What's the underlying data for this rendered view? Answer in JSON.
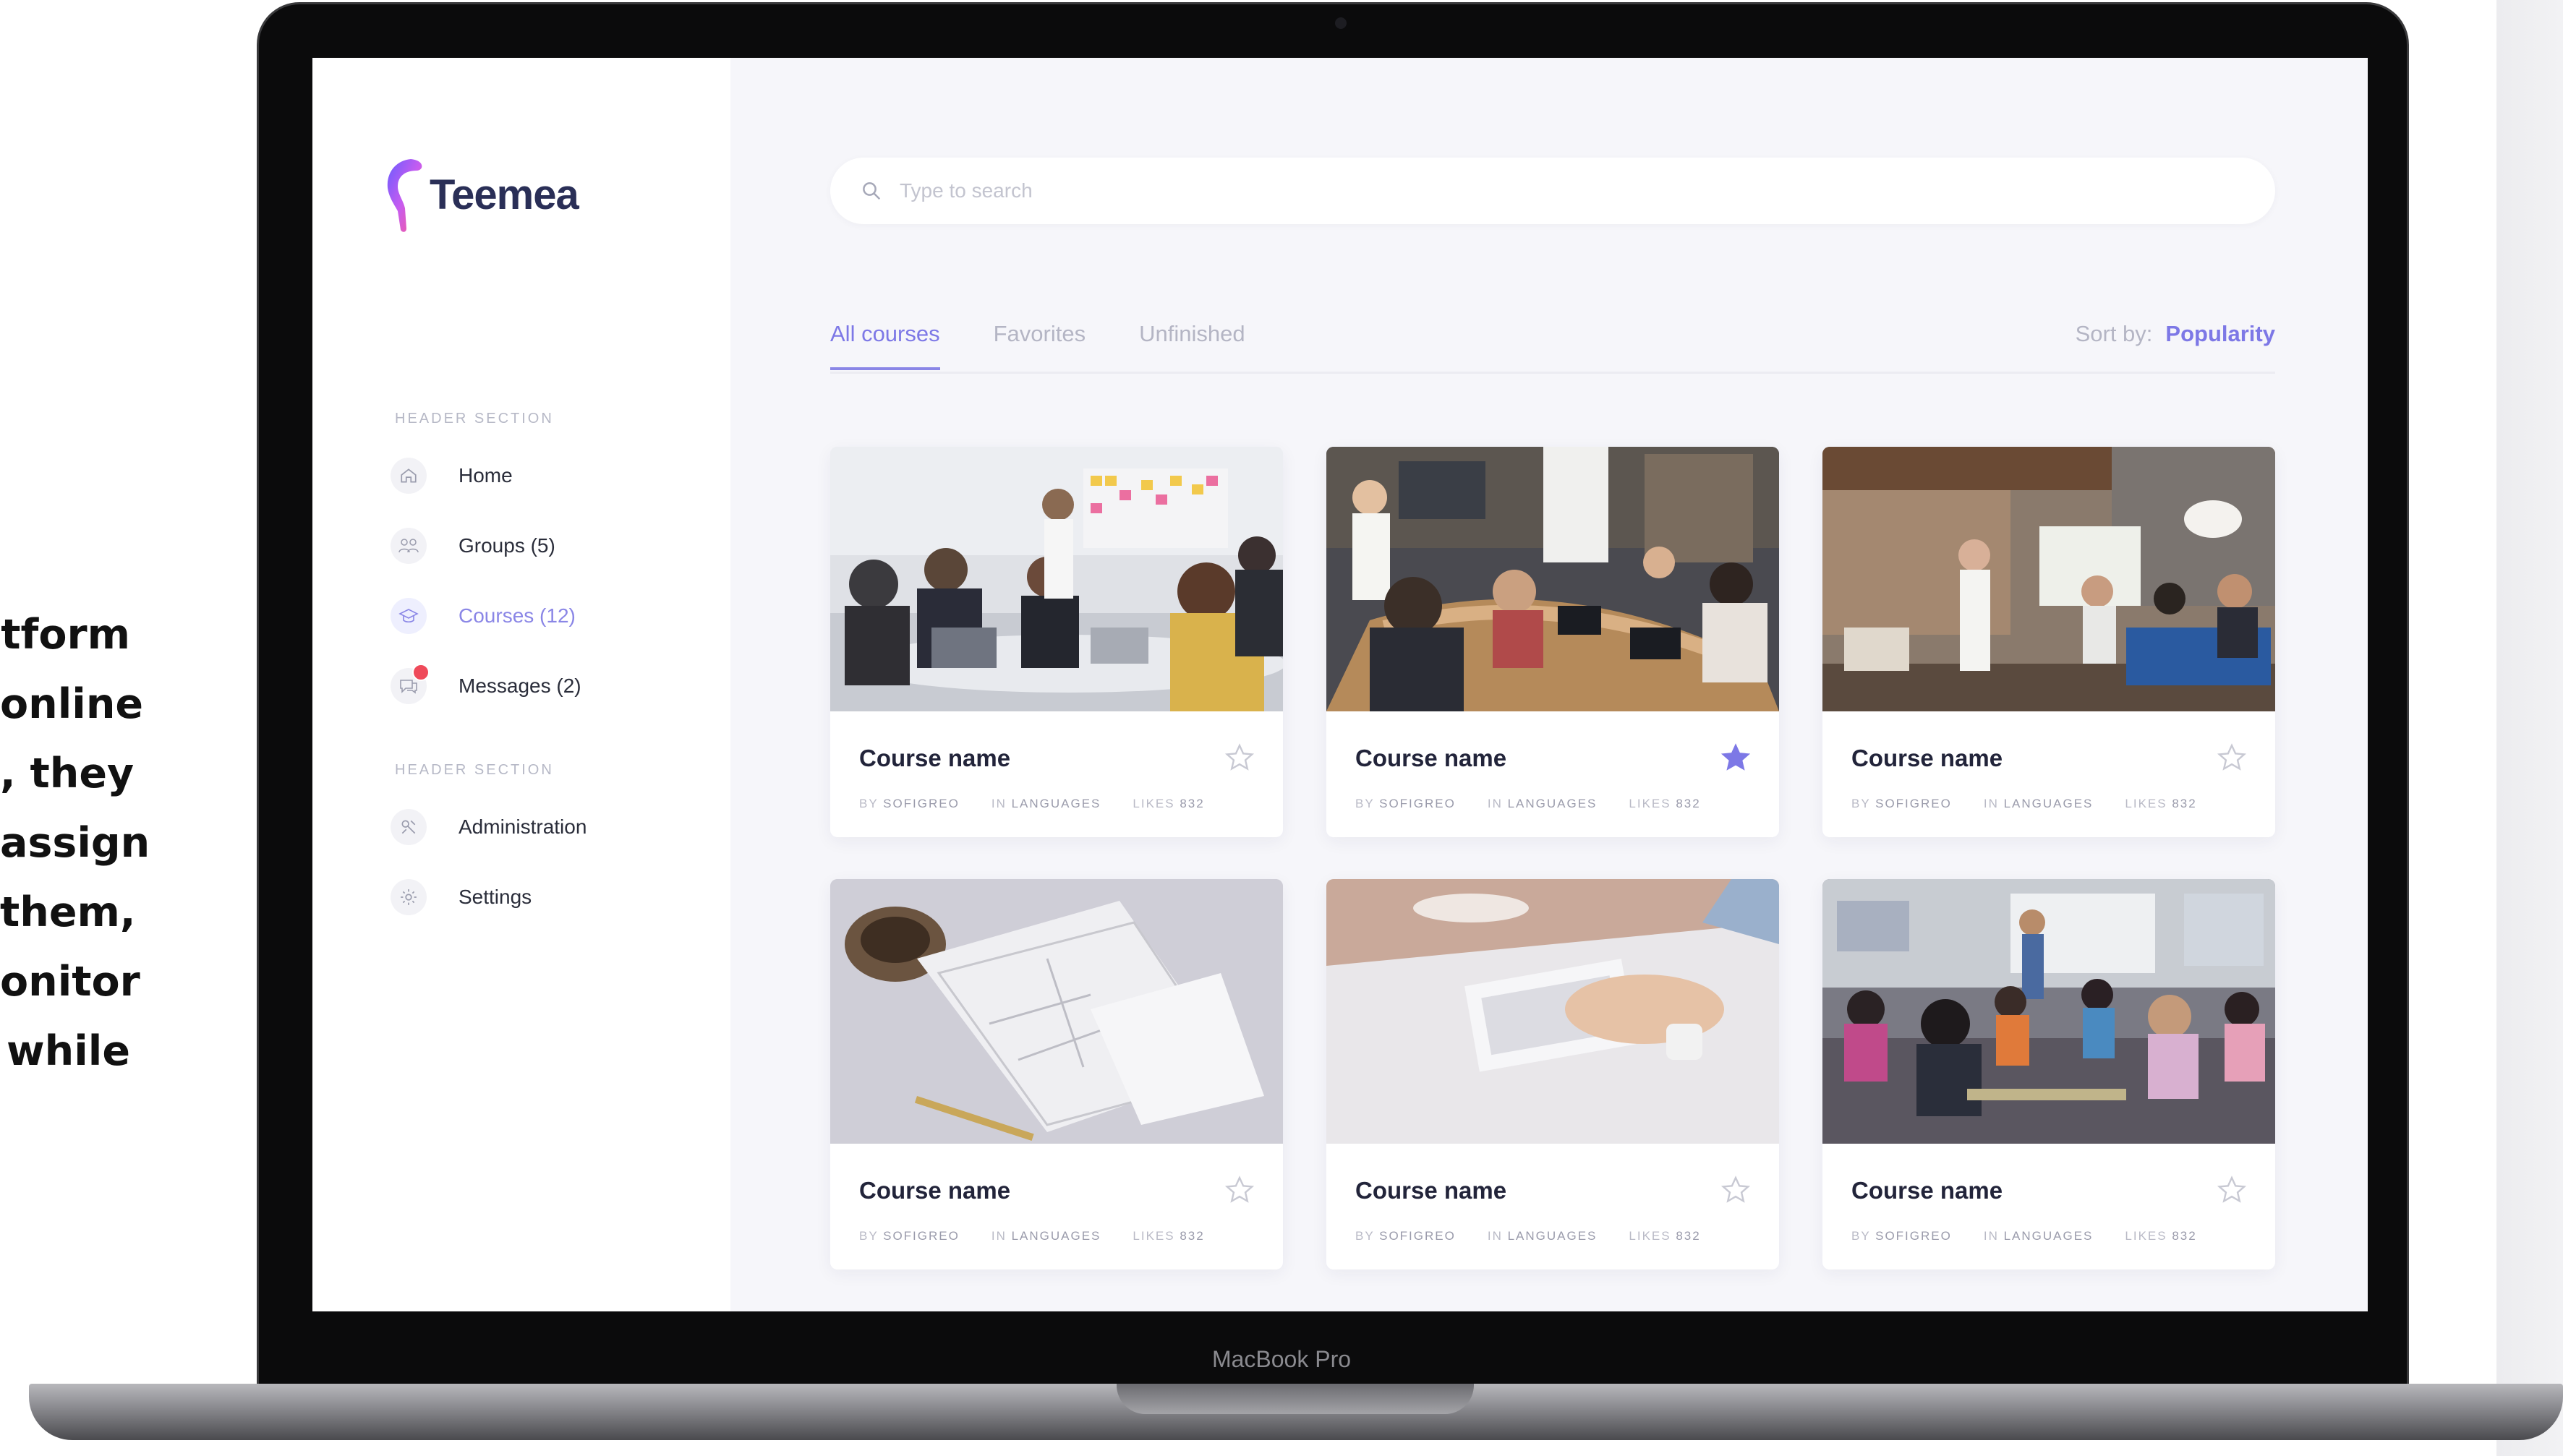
{
  "side_text_lines": [
    "tform",
    "online",
    ", they",
    "assign",
    "them,",
    "onitor",
    "while"
  ],
  "laptop_label": "MacBook Pro",
  "brand": {
    "name": "Teemea",
    "colors": {
      "accent": "#7d78e6",
      "badge": "#ef4a5a",
      "text": "#2a2f57"
    }
  },
  "sidebar": {
    "section1_title": "HEADER SECTION",
    "section2_title": "HEADER SECTION",
    "items": [
      {
        "label": "Home",
        "icon": "home-icon"
      },
      {
        "label": "Groups (5)",
        "icon": "groups-icon"
      },
      {
        "label": "Courses (12)",
        "icon": "courses-icon",
        "active": true
      },
      {
        "label": "Messages (2)",
        "icon": "messages-icon",
        "badge": true
      },
      {
        "label": "Administration",
        "icon": "administration-icon"
      },
      {
        "label": "Settings",
        "icon": "settings-icon"
      }
    ]
  },
  "search": {
    "placeholder": "Type to search"
  },
  "tabs": [
    {
      "label": "All courses",
      "active": true
    },
    {
      "label": "Favorites"
    },
    {
      "label": "Unfinished"
    }
  ],
  "sort": {
    "label": "Sort by:",
    "value": "Popularity"
  },
  "courses": [
    {
      "title": "Course name",
      "by": "BY",
      "author": "SOFIGREO",
      "in": "IN",
      "category": "LANGUAGES",
      "likes_label": "LIKES",
      "likes": "832",
      "favorited": false,
      "image": "meeting at whiteboard with sticky notes"
    },
    {
      "title": "Course name",
      "by": "BY",
      "author": "SOFIGREO",
      "in": "IN",
      "category": "LANGUAGES",
      "likes_label": "LIKES",
      "likes": "832",
      "favorited": true,
      "image": "conference room with laptops"
    },
    {
      "title": "Course name",
      "by": "BY",
      "author": "SOFIGREO",
      "in": "IN",
      "category": "LANGUAGES",
      "likes_label": "LIKES",
      "likes": "832",
      "favorited": false,
      "image": "presentation in brick loft"
    },
    {
      "title": "Course name",
      "by": "BY",
      "author": "SOFIGREO",
      "in": "IN",
      "category": "LANGUAGES",
      "likes_label": "LIKES",
      "likes": "832",
      "favorited": false,
      "image": "sketches on desk"
    },
    {
      "title": "Course name",
      "by": "BY",
      "author": "SOFIGREO",
      "in": "IN",
      "category": "LANGUAGES",
      "likes_label": "LIKES",
      "likes": "832",
      "favorited": false,
      "image": "hand typing on keyboard"
    },
    {
      "title": "Course name",
      "by": "BY",
      "author": "SOFIGREO",
      "in": "IN",
      "category": "LANGUAGES",
      "likes_label": "LIKES",
      "likes": "832",
      "favorited": false,
      "image": "classroom with students"
    }
  ]
}
